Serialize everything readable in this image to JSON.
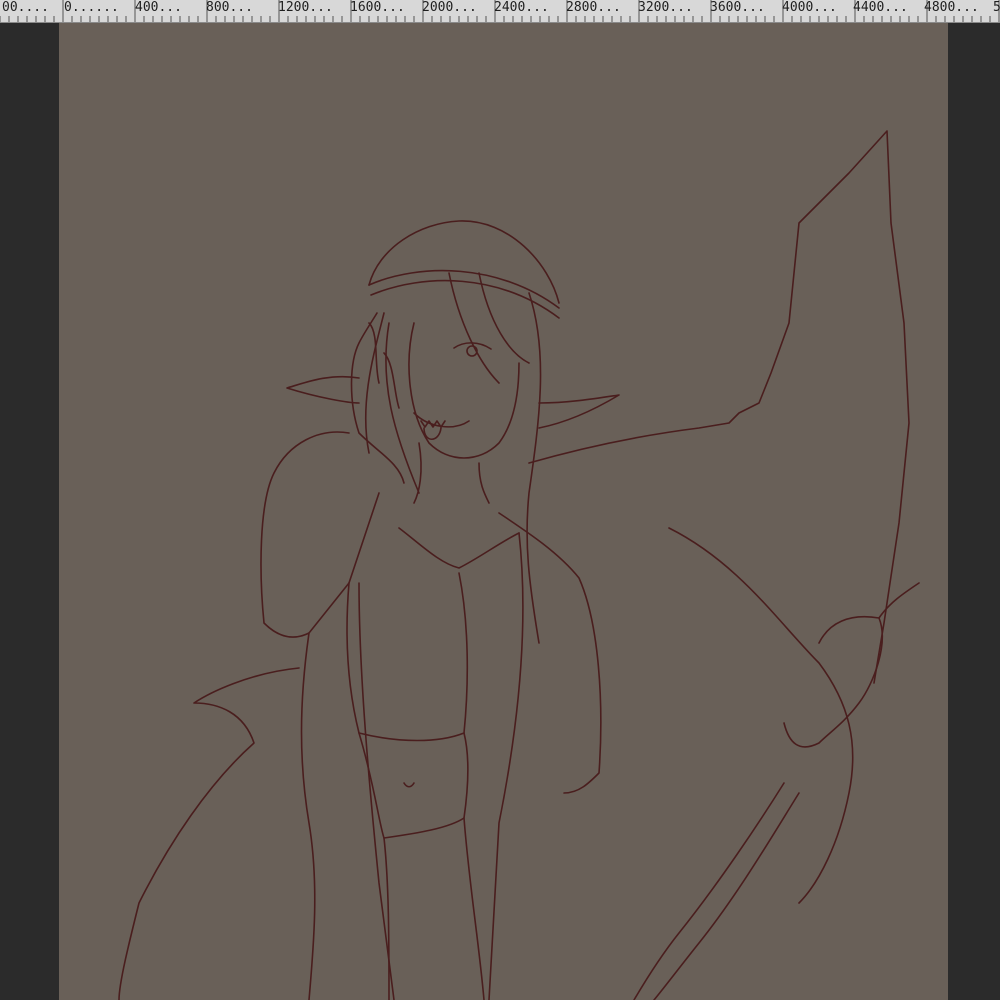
{
  "ruler": {
    "labels": [
      "00....",
      "0......",
      "400...",
      "800...",
      "1200...",
      "1600...",
      "2000...",
      "2400...",
      "2800...",
      "3200...",
      "3600...",
      "4000...",
      "4400...",
      "4800...",
      "5"
    ]
  },
  "canvas": {
    "background": "#696058",
    "line_color": "#4a1e1e"
  },
  "colors": {
    "workspace": "#2b2b2b",
    "ruler_bg": "#d8d8d8"
  }
}
